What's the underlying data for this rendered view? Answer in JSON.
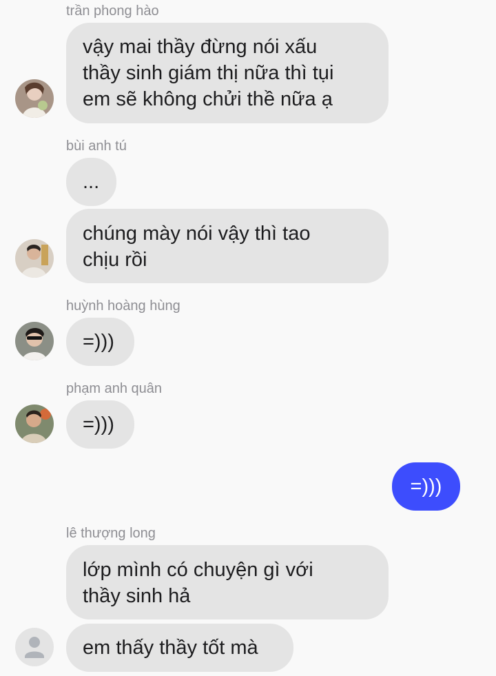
{
  "messages": [
    {
      "sender": "trần phong hào",
      "bubbles": [
        [
          "vậy mai thầy đừng nói xấu",
          "thầy sinh giám thị nữa thì tụi",
          "em sẽ không chửi thề nữa ạ"
        ]
      ]
    },
    {
      "sender": "bùi anh tú",
      "bubbles": [
        [
          "..."
        ],
        [
          "chúng mày nói vậy thì tao",
          "chịu rồi"
        ]
      ]
    },
    {
      "sender": "huỳnh hoàng hùng",
      "bubbles": [
        [
          "=)))"
        ]
      ]
    },
    {
      "sender": "phạm anh quân",
      "bubbles": [
        [
          "=)))"
        ]
      ]
    },
    {
      "sender": "",
      "own": true,
      "bubbles": [
        [
          "=)))"
        ]
      ]
    },
    {
      "sender": "lê thượng long",
      "bubbles": [
        [
          "lớp mình có chuyện gì với",
          "thầy sinh hả"
        ],
        [
          "em thấy thầy tốt mà"
        ]
      ]
    }
  ],
  "colors": {
    "background": "#f9f9f9",
    "incoming_bubble": "#e4e4e4",
    "outgoing_bubble": "#3d4dfd",
    "sender_name": "#8e8e93"
  },
  "avatars": [
    "user-photo-avatar",
    "user-photo-avatar",
    "user-photo-avatar",
    "user-photo-avatar",
    "default-person-icon"
  ]
}
